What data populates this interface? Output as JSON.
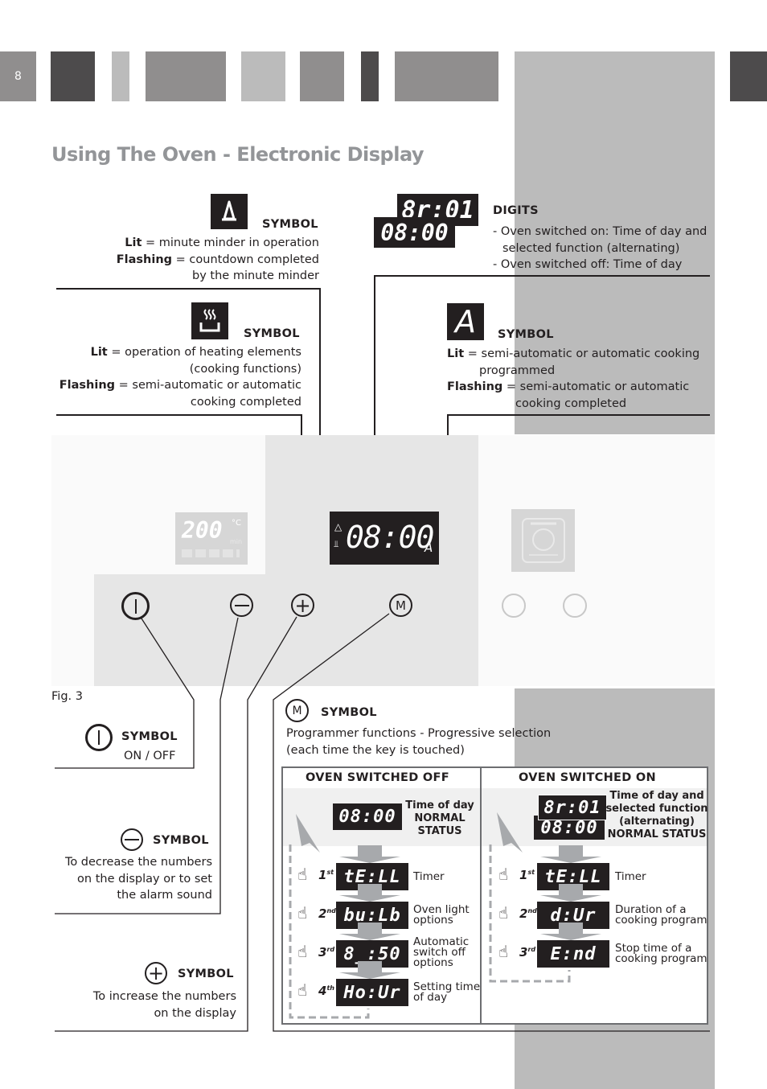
{
  "page": {
    "number": "8",
    "title": "Using The Oven - Electronic Display",
    "figure_label": "Fig. 3"
  },
  "colors": {
    "dark_bar": "#4d4b4c",
    "mid_bar": "#908e8e",
    "light_bar": "#bbbbbb",
    "title_gray": "#939598",
    "lcd_black": "#231f20"
  },
  "callouts": {
    "bell": {
      "icon": "bell-icon",
      "heading": "SYMBOL",
      "lit_label": "Lit",
      "lit_text": " = minute minder in operation",
      "flash_label": "Flashing",
      "flash_text": " = countdown completed",
      "flash_text2": "by the minute minder"
    },
    "digits": {
      "top_lcd": "8r:01",
      "bottom_lcd": "08:00",
      "heading": "DIGITS",
      "line1": "- Oven switched on: Time of day and",
      "line2": "selected function (alternating)",
      "line3": "- Oven switched off: Time of day"
    },
    "heat": {
      "icon": "heating-elements-icon",
      "heading": "SYMBOL",
      "lit_label": "Lit",
      "lit_text": " = operation of heating elements",
      "lit_text2": "(cooking functions)",
      "flash_label": "Flashing",
      "flash_text": " = semi-automatic or automatic",
      "flash_text2": "cooking completed"
    },
    "auto": {
      "icon_glyph": "A",
      "heading": "SYMBOL",
      "lit_label": "Lit",
      "lit_text": " = semi-automatic or automatic cooking",
      "lit_text2": "programmed",
      "flash_label": "Flashing",
      "flash_text": " = semi-automatic or automatic",
      "flash_text2": "cooking completed"
    }
  },
  "panel": {
    "temp_display": "200",
    "temp_unit": "°C",
    "temp_sub": "min",
    "main_display": "08:00",
    "main_display_suffix": "A",
    "buttons": [
      {
        "name": "power-button",
        "glyph": "|"
      },
      {
        "name": "minus-button",
        "glyph": "−"
      },
      {
        "name": "plus-button",
        "glyph": "+"
      },
      {
        "name": "m-button",
        "glyph": "M"
      }
    ]
  },
  "bottom_callouts": {
    "onoff": {
      "heading": "SYMBOL",
      "text": "ON / OFF"
    },
    "minus": {
      "heading": "SYMBOL",
      "line1": "To decrease the numbers",
      "line2": "on the display or to set",
      "line3": "the alarm sound"
    },
    "plus": {
      "heading": "SYMBOL",
      "line1": "To increase the numbers",
      "line2": "on the display"
    },
    "m": {
      "heading": "SYMBOL",
      "line1": "Programmer functions - Progressive selection",
      "line2": "(each time the key is touched)"
    }
  },
  "table": {
    "off": {
      "heading": "OVEN SWITCHED OFF",
      "status_display": "08:00",
      "status_l1": "Time of day",
      "status_l2": "NORMAL",
      "status_l3": "STATUS",
      "steps": [
        {
          "ord": "1",
          "sup": "st",
          "display": "tE:LL",
          "label1": "Timer",
          "label2": ""
        },
        {
          "ord": "2",
          "sup": "nd",
          "display": "bu:Lb",
          "label1": "Oven light",
          "label2": "options"
        },
        {
          "ord": "3",
          "sup": "rd",
          "display": "8_:50",
          "label1": "Automatic",
          "label2": "switch off",
          "label3": "options"
        },
        {
          "ord": "4",
          "sup": "th",
          "display": "Ho:Ur",
          "label1": "Setting time",
          "label2": "of day"
        }
      ]
    },
    "on": {
      "heading": "OVEN SWITCHED ON",
      "status_display_top": "8r:01",
      "status_display_bottom": "08:00",
      "status_l1": "Time of day and",
      "status_l2": "selected function",
      "status_l3": "(alternating)",
      "status_l4": "NORMAL STATUS",
      "steps": [
        {
          "ord": "1",
          "sup": "st",
          "display": "tE:LL",
          "label1": "Timer",
          "label2": ""
        },
        {
          "ord": "2",
          "sup": "nd",
          "display": "d:Ur",
          "label1": "Duration of a",
          "label2": "cooking program"
        },
        {
          "ord": "3",
          "sup": "rd",
          "display": "E:nd",
          "label1": "Stop time of a",
          "label2": "cooking program"
        }
      ]
    }
  }
}
